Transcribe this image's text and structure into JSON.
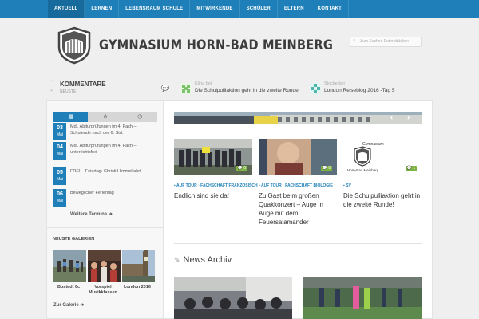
{
  "nav": {
    "items": [
      {
        "label": "Aktuell"
      },
      {
        "label": "Lernen"
      },
      {
        "label": "Lebensraum Schule"
      },
      {
        "label": "Mitwirkende"
      },
      {
        "label": "Schüler"
      },
      {
        "label": "Eltern"
      },
      {
        "label": "Kontakt"
      }
    ]
  },
  "header": {
    "title": "GYMNASIUM HORN-BAD MEINBERG",
    "search_placeholder": "Zum Suchen Enter drücken"
  },
  "comments": {
    "title": "KOMMENTARE",
    "subtitle": "NEUSTE",
    "items": [
      {
        "author": "Elina bei",
        "text": "Die Schulpulliaktion geht in die zweite Runde!",
        "color": "#7cc36b"
      },
      {
        "author": "Stocke bei",
        "text": "London Reiseblog 2016 -Tag 5",
        "color": "#4db6ac"
      }
    ]
  },
  "sidebar": {
    "tabs": [
      {
        "icon": "calendar-icon",
        "glyph": "▦"
      },
      {
        "icon": "cutlery-icon",
        "glyph": "⋔"
      },
      {
        "icon": "clock-icon",
        "glyph": "◷"
      }
    ],
    "events": [
      {
        "day": "03",
        "month": "Mai",
        "text": "Mdl. Abiturprüfungen im 4. Fach – Schulende nach der 6. Std."
      },
      {
        "day": "04",
        "month": "Mai",
        "text": "Mdl. Abiturprüfungen im 4. Fach – unterrichtsfrei"
      },
      {
        "day": "05",
        "month": "Mai",
        "text": "FREI – Feiertag: Christi Himmelfahrt"
      },
      {
        "day": "06",
        "month": "Mai",
        "text": "Beweglicher Ferientag"
      }
    ],
    "more_link": "Weitere Termine ➔",
    "galleries_title": "NEUSTE GALERIEN",
    "galleries": [
      {
        "caption": "Bustedt 6c"
      },
      {
        "caption": "Vorspiel Musikklassen"
      },
      {
        "caption": "London 2016"
      }
    ],
    "gallery_link": "Zur Galerie ➔"
  },
  "main": {
    "slider": {
      "prev": "‹",
      "next": "›"
    },
    "cards": [
      {
        "badge": "💬 0",
        "category": "AUF TOUR · FACHSCHAFT FRANZÖSISCH",
        "title": "Endlich sind sie da!"
      },
      {
        "badge": "💬 0",
        "category": "AUF TOUR · FACHSCHAFT BIOLOGIE",
        "title": "Zu Gast beim großen Quakkonzert – Auge in Auge mit dem Feuersalamander"
      },
      {
        "badge": "💬 1",
        "category": "SV",
        "title": "Die Schulpulliaktion geht in die zweite Runde!"
      }
    ],
    "archive_title": "News Archiv."
  },
  "logo": {
    "line1": "Gymnasium",
    "line2": "Horn-Bad Meinberg"
  }
}
